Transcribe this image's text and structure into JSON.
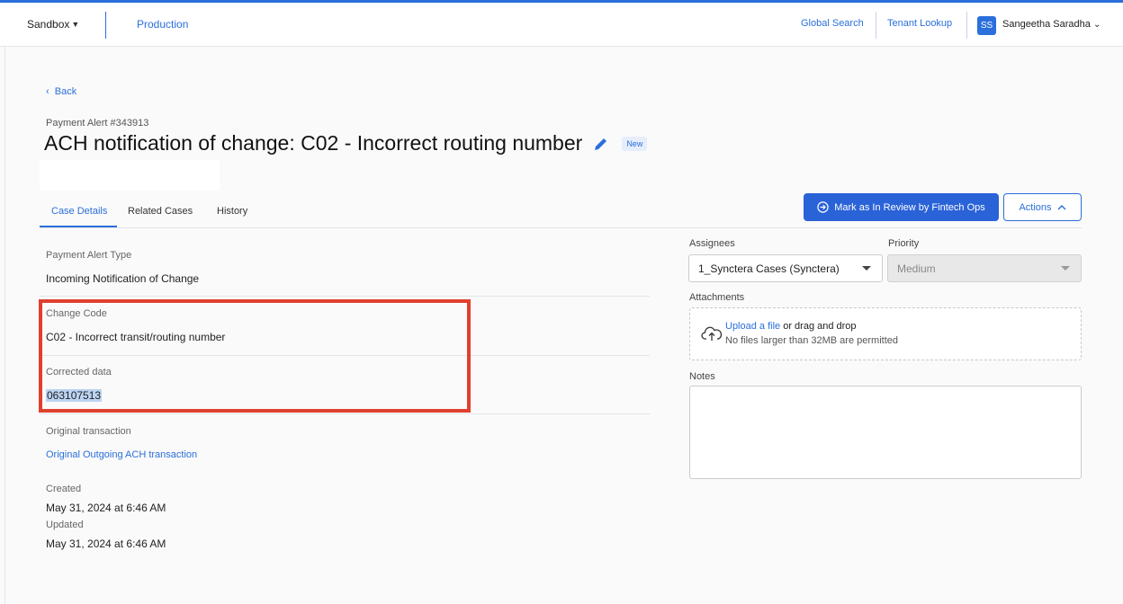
{
  "topbar": {
    "environment": "Sandbox",
    "environment_link": "Production",
    "global_search": "Global Search",
    "tenant_lookup": "Tenant Lookup",
    "user_initials": "SS",
    "user_name": "Sangeetha Saradha"
  },
  "header": {
    "back": "Back",
    "alert_id": "Payment Alert #343913",
    "title": "ACH notification of change: C02 - Incorrect routing number",
    "status_badge": "New"
  },
  "tabs": [
    "Case Details",
    "Related Cases",
    "History"
  ],
  "actions": {
    "primary": "Mark as In Review by Fintech Ops",
    "secondary": "Actions"
  },
  "details": {
    "payment_alert_type_label": "Payment Alert Type",
    "payment_alert_type_value": "Incoming Notification of Change",
    "change_code_label": "Change Code",
    "change_code_value": "C02 - Incorrect transit/routing number",
    "corrected_data_label": "Corrected data",
    "corrected_data_value": "063107513",
    "original_transaction_label": "Original transaction",
    "original_transaction_link": "Original Outgoing ACH transaction",
    "created_label": "Created",
    "created_value": "May 31, 2024 at 6:46 AM",
    "updated_label": "Updated",
    "updated_value": "May 31, 2024 at 6:46 AM"
  },
  "side": {
    "assignees_label": "Assignees",
    "assignees_value": "1_Synctera Cases (Synctera)",
    "priority_label": "Priority",
    "priority_value": "Medium",
    "attachments_label": "Attachments",
    "upload_link": "Upload a file",
    "upload_rest": " or drag and drop",
    "upload_note": "No files larger than 32MB are permitted",
    "notes_label": "Notes"
  },
  "colors": {
    "accent": "#2a6fdb",
    "highlight_box": "#e0402e"
  }
}
